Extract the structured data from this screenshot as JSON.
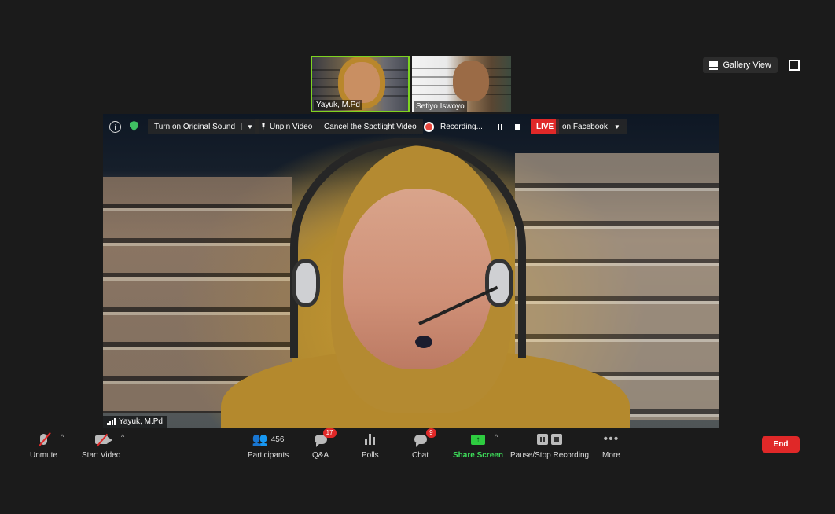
{
  "thumbnails": [
    {
      "name": "Yayuk, M.Pd"
    },
    {
      "name": "Setiyo Iswoyo"
    }
  ],
  "top_right": {
    "gallery_label": "Gallery View",
    "gallery_icon": "grid-icon",
    "fullscreen_icon": "fullscreen-icon"
  },
  "video_toolbar": {
    "original_sound": "Turn on Original Sound",
    "unpin": "Unpin Video",
    "cancel_spotlight": "Cancel the Spotlight Video",
    "recording": "Recording...",
    "live": "LIVE",
    "live_target": "on Facebook"
  },
  "speaker": {
    "name": "Yayuk, M.Pd"
  },
  "bottom_toolbar": {
    "unmute": "Unmute",
    "start_video": "Start Video",
    "participants": "Participants",
    "participants_count": "456",
    "qa": "Q&A",
    "qa_badge": "17",
    "polls": "Polls",
    "chat": "Chat",
    "chat_badge": "9",
    "share": "Share Screen",
    "pause_stop": "Pause/Stop Recording",
    "more": "More",
    "end": "End"
  },
  "colors": {
    "live": "#e02828",
    "share": "#2ecc40",
    "active_border": "#7ed321",
    "end": "#e02828"
  }
}
